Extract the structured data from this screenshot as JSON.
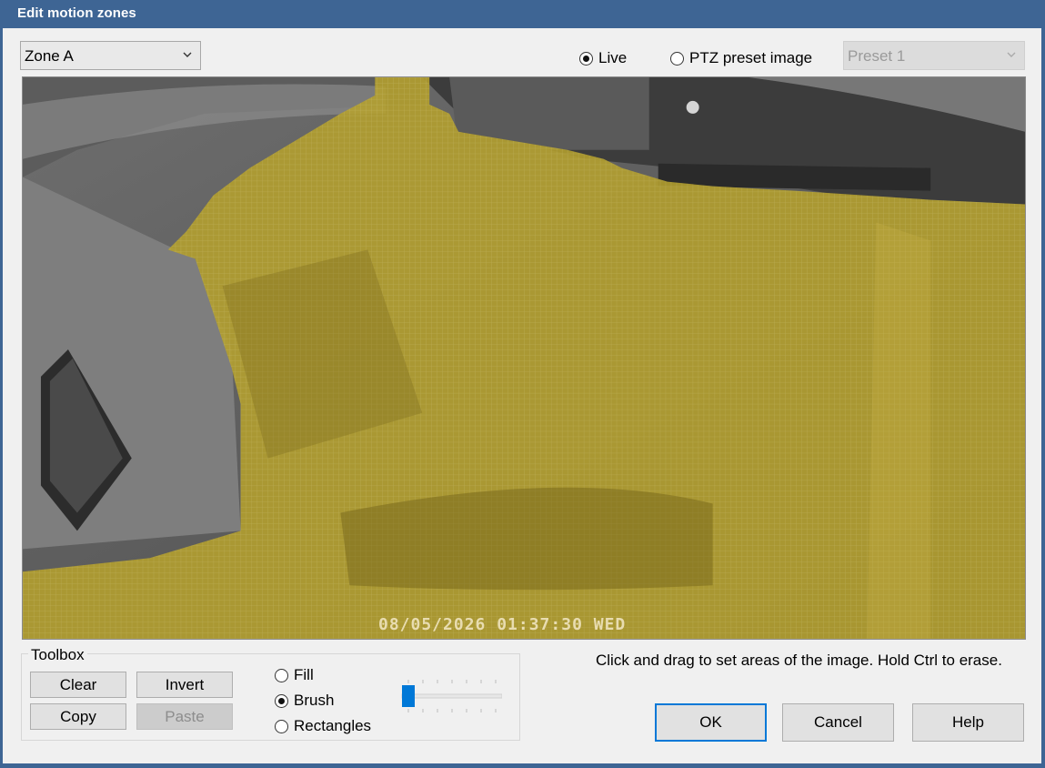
{
  "window": {
    "title": "Edit motion zones"
  },
  "zone_select": {
    "value": "Zone A"
  },
  "source": {
    "live_label": "Live",
    "live_selected": true,
    "ptz_label": "PTZ preset image",
    "ptz_selected": false
  },
  "preset_select": {
    "value": "Preset 1",
    "disabled": true
  },
  "camera": {
    "timestamp": "08/05/2026 01:37:30 WED",
    "zone_color": "#b5a02d"
  },
  "toolbox": {
    "label": "Toolbox",
    "clear_label": "Clear",
    "invert_label": "Invert",
    "copy_label": "Copy",
    "paste_label": "Paste",
    "modes": [
      {
        "label": "Fill",
        "selected": false
      },
      {
        "label": "Brush",
        "selected": true
      },
      {
        "label": "Rectangles",
        "selected": false
      }
    ],
    "brush_size_fraction": 0.0
  },
  "hint": "Click and drag to set areas of the image.  Hold Ctrl to erase.",
  "actions": {
    "ok_label": "OK",
    "cancel_label": "Cancel",
    "help_label": "Help"
  },
  "colors": {
    "titlebar": "#3e6594",
    "accent": "#0078d7"
  }
}
